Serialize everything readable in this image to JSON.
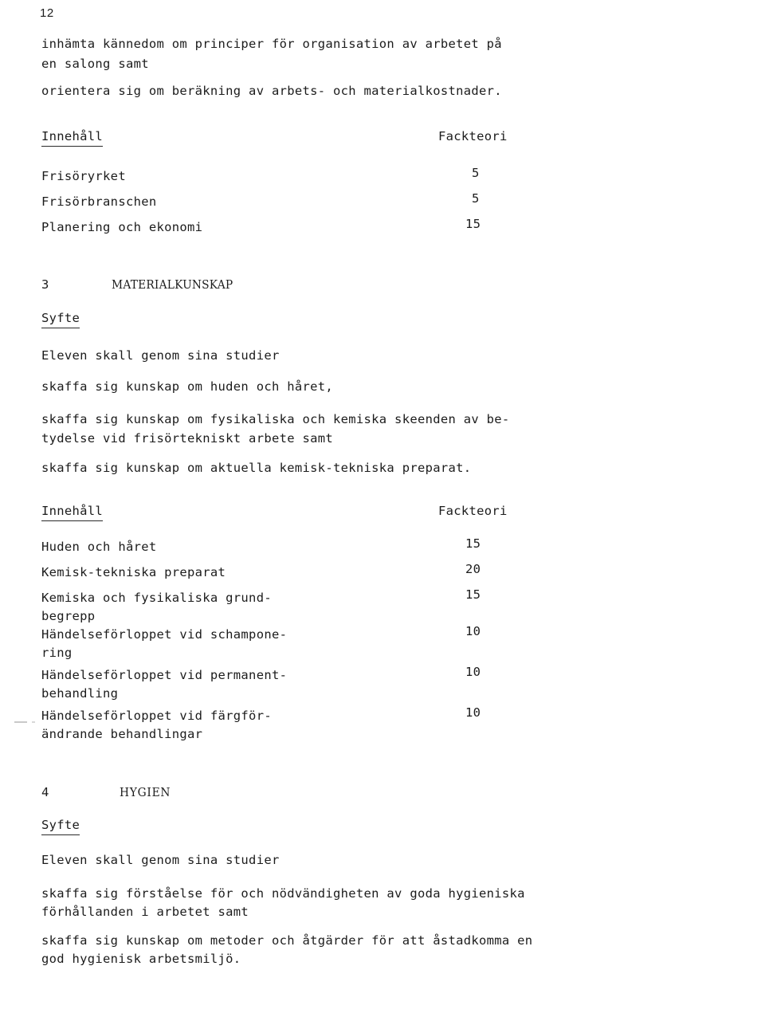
{
  "page": {
    "folio": "12"
  },
  "intro": {
    "para1_line1": "inhämta kännedom om principer för organisation av arbetet på",
    "para1_line2": "en salong samt",
    "para2_line1": "orientera sig om beräkning av arbets- och materialkostnader."
  },
  "table1": {
    "heading_label": "Innehåll",
    "column_label": "Fackteori",
    "rows": [
      {
        "label": "Frisöryrket",
        "value": "5"
      },
      {
        "label": "Frisörbranschen",
        "value": "5"
      },
      {
        "label": "Planering och ekonomi",
        "value": "15"
      }
    ]
  },
  "chapter3": {
    "number": "3",
    "title": "MATERIALKUNSKAP",
    "purpose_heading": "Syfte",
    "lead": "Eleven skall genom sina studier",
    "goal1": "skaffa sig kunskap om huden och håret,",
    "goal2_line1": "skaffa sig kunskap om fysikaliska och kemiska skeenden av be-",
    "goal2_line2": "tydelse vid frisörtekniskt arbete samt",
    "goal3": "skaffa sig kunskap om aktuella kemisk-tekniska preparat."
  },
  "table2": {
    "heading_label": "Innehåll",
    "column_label": "Fackteori",
    "rows": [
      {
        "label_line1": "Huden och håret",
        "label_line2": "",
        "value": "15"
      },
      {
        "label_line1": "Kemisk-tekniska preparat",
        "label_line2": "",
        "value": "20"
      },
      {
        "label_line1": "Kemiska och fysikaliska grund-",
        "label_line2": "begrepp",
        "value": "15"
      },
      {
        "label_line1": "Händelseförloppet vid schampone-",
        "label_line2": "ring",
        "value": "10"
      },
      {
        "label_line1": "Händelseförloppet vid permanent-",
        "label_line2": "behandling",
        "value": "10"
      },
      {
        "label_line1": "Händelseförloppet vid färgför-",
        "label_line2": "ändrande behandlingar",
        "value": "10"
      }
    ]
  },
  "chapter4": {
    "number": "4",
    "title": "HYGIEN",
    "purpose_heading": "Syfte",
    "lead": "Eleven skall genom sina studier",
    "goal1_line1": "skaffa sig förståelse för och nödvändigheten av goda hygieniska",
    "goal1_line2": "förhållanden i arbetet samt",
    "goal2_line1": "skaffa sig kunskap om metoder och åtgärder för att åstadkomma en",
    "goal2_line2": "god hygienisk arbetsmiljö."
  }
}
